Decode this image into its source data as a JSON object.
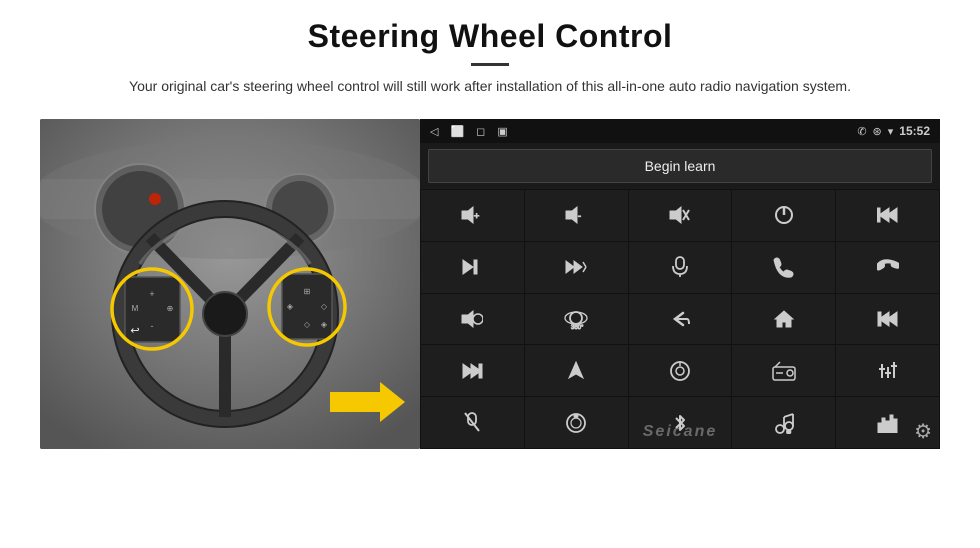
{
  "page": {
    "title": "Steering Wheel Control",
    "divider": true,
    "subtitle": "Your original car's steering wheel control will still work after installation of this all-in-one auto radio navigation system."
  },
  "status_bar": {
    "back_icon": "◁",
    "home_icon": "⬜",
    "square_icon": "◻",
    "signal_icon": "▣▌",
    "phone_icon": "✆",
    "location_icon": "⊛",
    "wifi_icon": "▾",
    "time": "15:52"
  },
  "begin_learn": {
    "label": "Begin learn"
  },
  "controls": [
    {
      "icon": "vol+",
      "unicode": "🔊+",
      "symbol": "vol-up"
    },
    {
      "icon": "vol-",
      "unicode": "🔉-",
      "symbol": "vol-down"
    },
    {
      "icon": "mute",
      "unicode": "🔇",
      "symbol": "mute"
    },
    {
      "icon": "power",
      "unicode": "⏻",
      "symbol": "power"
    },
    {
      "icon": "prev-track",
      "unicode": "|◀◀",
      "symbol": "prev-track"
    },
    {
      "icon": "skip-fwd",
      "unicode": "⏭",
      "symbol": "skip-fwd"
    },
    {
      "icon": "fast-fwd",
      "unicode": "⏩×",
      "symbol": "fast-fwd"
    },
    {
      "icon": "mic",
      "unicode": "🎤",
      "symbol": "mic"
    },
    {
      "icon": "phone",
      "unicode": "✆",
      "symbol": "phone"
    },
    {
      "icon": "hang-up",
      "unicode": "↩",
      "symbol": "hang-up"
    },
    {
      "icon": "speaker",
      "unicode": "🔈",
      "symbol": "speaker"
    },
    {
      "icon": "360",
      "unicode": "⊙",
      "symbol": "360-cam"
    },
    {
      "icon": "back",
      "unicode": "↩",
      "symbol": "back"
    },
    {
      "icon": "home",
      "unicode": "⌂",
      "symbol": "home"
    },
    {
      "icon": "skip-back",
      "unicode": "|◀◀",
      "symbol": "skip-back"
    },
    {
      "icon": "next",
      "unicode": "⏭",
      "symbol": "next"
    },
    {
      "icon": "nav",
      "unicode": "▶",
      "symbol": "navigation"
    },
    {
      "icon": "source",
      "unicode": "⊖",
      "symbol": "source"
    },
    {
      "icon": "radio",
      "unicode": "📻",
      "symbol": "radio"
    },
    {
      "icon": "eq",
      "unicode": "⫶",
      "symbol": "equalizer"
    },
    {
      "icon": "mic2",
      "unicode": "🎤",
      "symbol": "mic2"
    },
    {
      "icon": "knob",
      "unicode": "◎",
      "symbol": "knob"
    },
    {
      "icon": "bluetooth",
      "unicode": "⚡",
      "symbol": "bluetooth"
    },
    {
      "icon": "music",
      "unicode": "♫",
      "symbol": "music"
    },
    {
      "icon": "spectrum",
      "unicode": "|||",
      "symbol": "spectrum"
    }
  ],
  "watermark": {
    "text": "Seicane"
  },
  "icons": {
    "gear": "⚙"
  }
}
